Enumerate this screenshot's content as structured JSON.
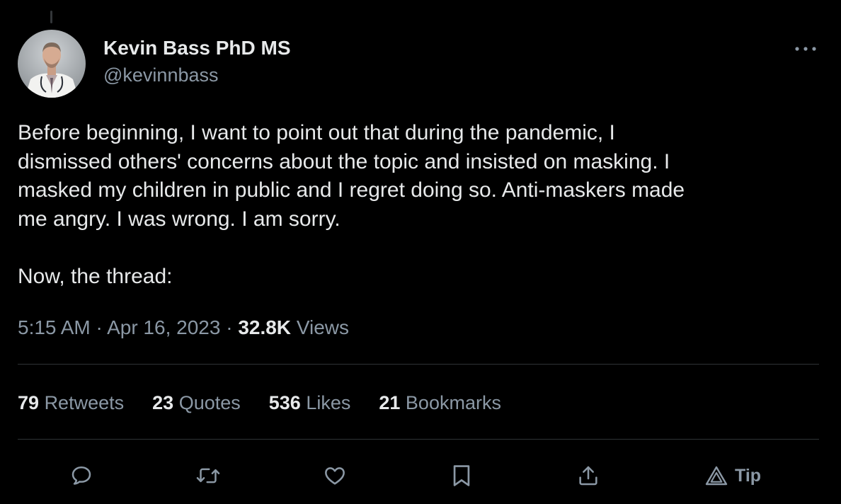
{
  "author": {
    "name": "Kevin Bass PhD MS",
    "handle": "@kevinnbass"
  },
  "tweet": {
    "text": "Before beginning, I want to point out that during the pandemic, I\ndismissed others' concerns about the topic and insisted on masking. I\nmasked my children in public and I regret doing so. Anti-maskers made\nme angry. I was wrong. I am sorry.\n\nNow, the thread:",
    "time": "5:15 AM",
    "separator": "·",
    "date": "Apr 16, 2023",
    "views_count": "32.8K",
    "views_label": "Views"
  },
  "stats": [
    {
      "count": "79",
      "label": "Retweets"
    },
    {
      "count": "23",
      "label": "Quotes"
    },
    {
      "count": "536",
      "label": "Likes"
    },
    {
      "count": "21",
      "label": "Bookmarks"
    }
  ],
  "actions": {
    "icons": [
      "reply-icon",
      "retweet-icon",
      "like-icon",
      "bookmark-icon",
      "share-icon",
      "tip-icon"
    ],
    "tip_label": "Tip"
  },
  "colors": {
    "background": "#000000",
    "primary_text": "#e7e9ea",
    "secondary_text": "#8b98a5",
    "divider": "#2f3336"
  }
}
